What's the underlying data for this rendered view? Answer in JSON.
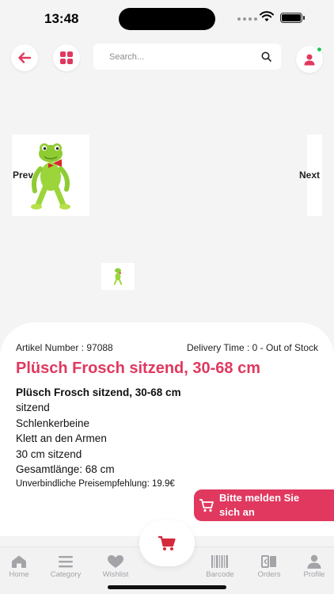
{
  "status_bar": {
    "time": "13:48"
  },
  "header": {
    "search_placeholder": "Search..."
  },
  "carousel": {
    "prev_label": "Prev",
    "next_label": "Next"
  },
  "product": {
    "article_number": "Artikel Number : 97088",
    "delivery_time": "Delivery Time : 0 - Out of Stock",
    "title": "Plüsch Frosch sitzend, 30-68 cm",
    "description": {
      "heading": "Plüsch Frosch sitzend, 30-68 cm",
      "lines": [
        "sitzend",
        "Schlenkerbeine",
        "Klett an den Armen",
        "30 cm sitzend",
        "Gesamtlänge: 68 cm"
      ],
      "price_note": "Unverbindliche Preisempfehlung: 19.9€"
    },
    "notify_button": "Bitte melden Sie sich an"
  },
  "tabs": [
    {
      "label": "Home",
      "icon": "home-icon"
    },
    {
      "label": "Category",
      "icon": "category-icon"
    },
    {
      "label": "Wishlist",
      "icon": "heart-icon"
    },
    {
      "label": "Barcode",
      "icon": "barcode-icon"
    },
    {
      "label": "Orders",
      "icon": "orders-icon"
    },
    {
      "label": "Profile",
      "icon": "profile-icon"
    }
  ],
  "colors": {
    "accent": "#e0385f",
    "online": "#22c55e",
    "tab_inactive": "#a3a3a8"
  }
}
